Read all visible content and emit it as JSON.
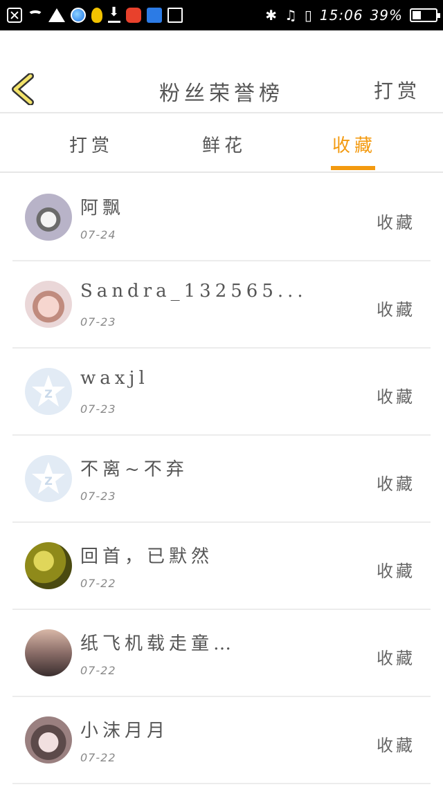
{
  "status_bar": {
    "time": "15:06",
    "battery": "39%",
    "battery_level": 0.39
  },
  "header": {
    "title": "粉丝荣誉榜",
    "action": "打赏"
  },
  "tabs": [
    {
      "label": "打赏",
      "active": false
    },
    {
      "label": "鲜花",
      "active": false
    },
    {
      "label": "收藏",
      "active": true
    }
  ],
  "colors": {
    "accent": "#f39a10",
    "text": "#555555",
    "divider": "#ececec"
  },
  "list": [
    {
      "name": "阿飘",
      "date": "07-24",
      "action": "收藏",
      "avatar": "husky"
    },
    {
      "name": "Sandra_132565...",
      "date": "07-23",
      "action": "收藏",
      "avatar": "anime-girl"
    },
    {
      "name": "waxjl",
      "date": "07-23",
      "action": "收藏",
      "avatar": "qq-default"
    },
    {
      "name": "不离~不弃",
      "date": "07-23",
      "action": "收藏",
      "avatar": "qq-default"
    },
    {
      "name": "回首，已默然",
      "date": "07-22",
      "action": "收藏",
      "avatar": "green-glow"
    },
    {
      "name": "纸飞机载走童…",
      "date": "07-22",
      "action": "收藏",
      "avatar": "photo"
    },
    {
      "name": "小沫月月",
      "date": "07-22",
      "action": "收藏",
      "avatar": "anime-girl-dark"
    }
  ]
}
